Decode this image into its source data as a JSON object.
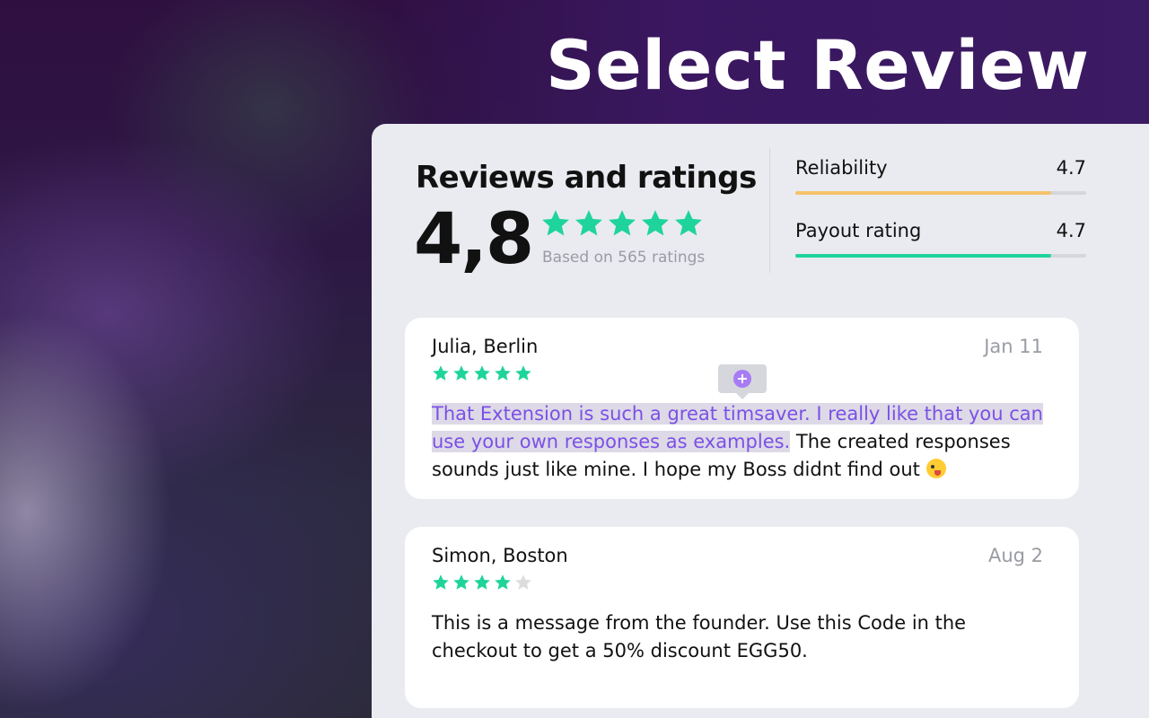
{
  "headline": "Select Review",
  "summary": {
    "title": "Reviews and ratings",
    "score": "4,8",
    "stars": 5,
    "based_on": "Based on 565 ratings"
  },
  "metrics": [
    {
      "label": "Reliability",
      "value": "4.7",
      "fraction": 0.88,
      "color": "#f7c26b"
    },
    {
      "label": "Payout rating",
      "value": "4.7",
      "fraction": 0.88,
      "color": "#1fd49a"
    }
  ],
  "reviews": [
    {
      "author": "Julia, Berlin",
      "date": "Jan 11",
      "stars": 5,
      "highlighted": "That Extension is such a great timsaver. I really like that you can use your own responses as examples.",
      "rest": " The created responses sounds just like mine. I hope my Boss didnt find out "
    },
    {
      "author": "Simon, Boston",
      "date": "Aug 2",
      "stars": 4,
      "text": "This is a message from the founder. Use this Code in the checkout to get a 50% discount EGG50."
    }
  ],
  "colors": {
    "star_filled": "#1fd49a",
    "star_empty": "#dcdcdf",
    "highlight_text": "#7b50e6",
    "add_icon": "#a77cf4"
  },
  "icons": {
    "star": "star-icon",
    "add": "plus-circle-icon",
    "emoji": "winking-face-with-tongue-icon"
  }
}
